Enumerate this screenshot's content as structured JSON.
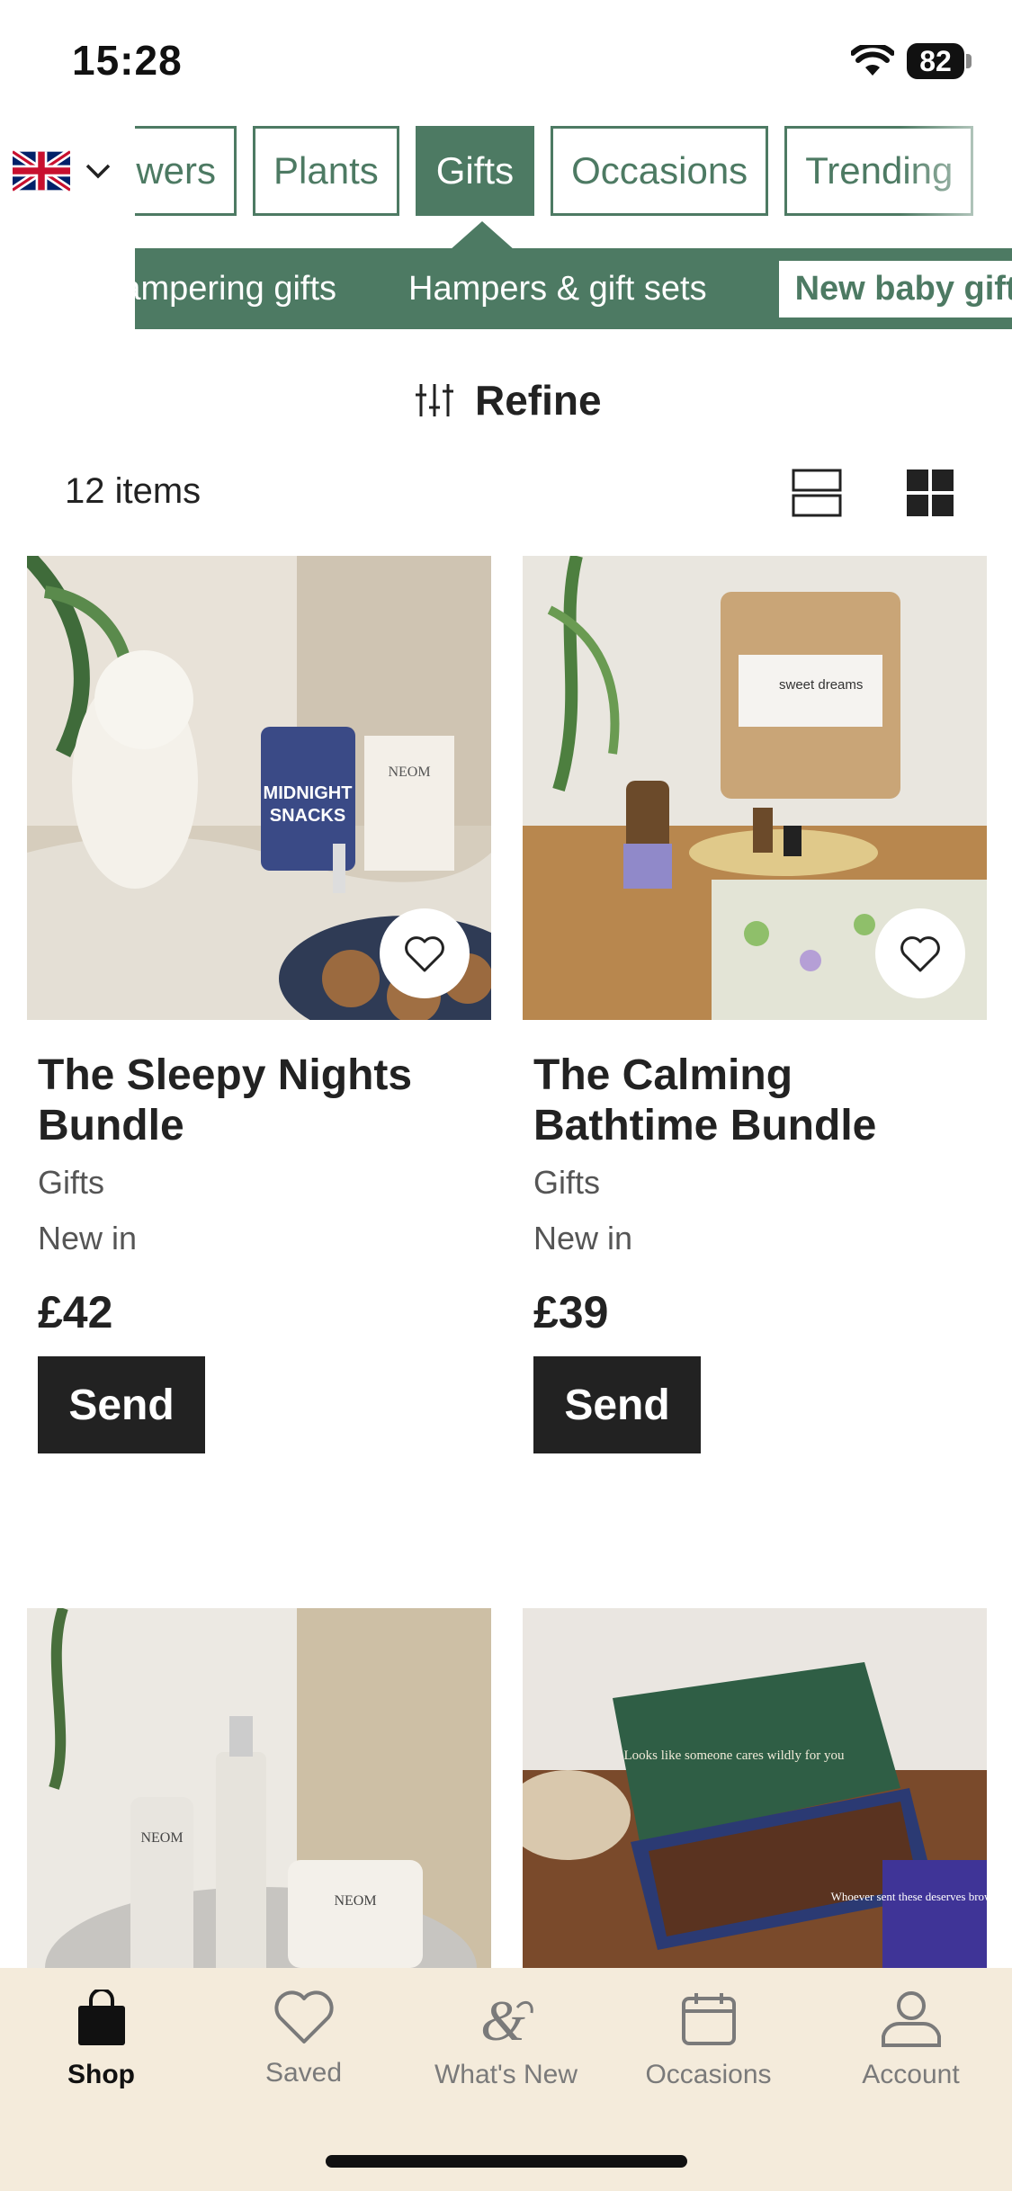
{
  "status": {
    "time": "15:28",
    "battery": "82"
  },
  "categories": {
    "items": [
      "Flowers",
      "Plants",
      "Gifts",
      "Occasions",
      "Trending"
    ],
    "active": "Gifts",
    "flag": "uk-flag-icon"
  },
  "subcategories": {
    "items": [
      "Pampering gifts",
      "Hampers & gift sets",
      "New baby gifts"
    ],
    "active": "New baby gifts"
  },
  "refine": {
    "label": "Refine",
    "icon": "sliders-icon"
  },
  "results": {
    "count_label": "12 items"
  },
  "products": [
    {
      "title": "The Sleepy Nights Bundle",
      "category": "Gifts",
      "badge": "New in",
      "price": "£42",
      "cta": "Send"
    },
    {
      "title": "The Calming Bathtime Bundle",
      "category": "Gifts",
      "badge": "New in",
      "price": "£39",
      "cta": "Send"
    },
    {
      "title": "",
      "category": "",
      "badge": "",
      "price": "",
      "cta": ""
    },
    {
      "title": "",
      "category": "",
      "badge": "",
      "price": "",
      "cta": "",
      "box_text": "Looks like someone cares wildly for you",
      "card_text": "Whoever sent these deserves brownie points"
    }
  ],
  "bottom_nav": {
    "tabs": [
      {
        "label": "Shop",
        "icon": "shopping-bag-icon"
      },
      {
        "label": "Saved",
        "icon": "heart-icon"
      },
      {
        "label": "What's New",
        "icon": "ampersand-logo-icon"
      },
      {
        "label": "Occasions",
        "icon": "calendar-icon"
      },
      {
        "label": "Account",
        "icon": "person-icon"
      }
    ],
    "active": "Shop"
  },
  "colors": {
    "brand_green": "#4d7a63",
    "nav_bg": "#f4ebdb",
    "button_dark": "#222222"
  }
}
